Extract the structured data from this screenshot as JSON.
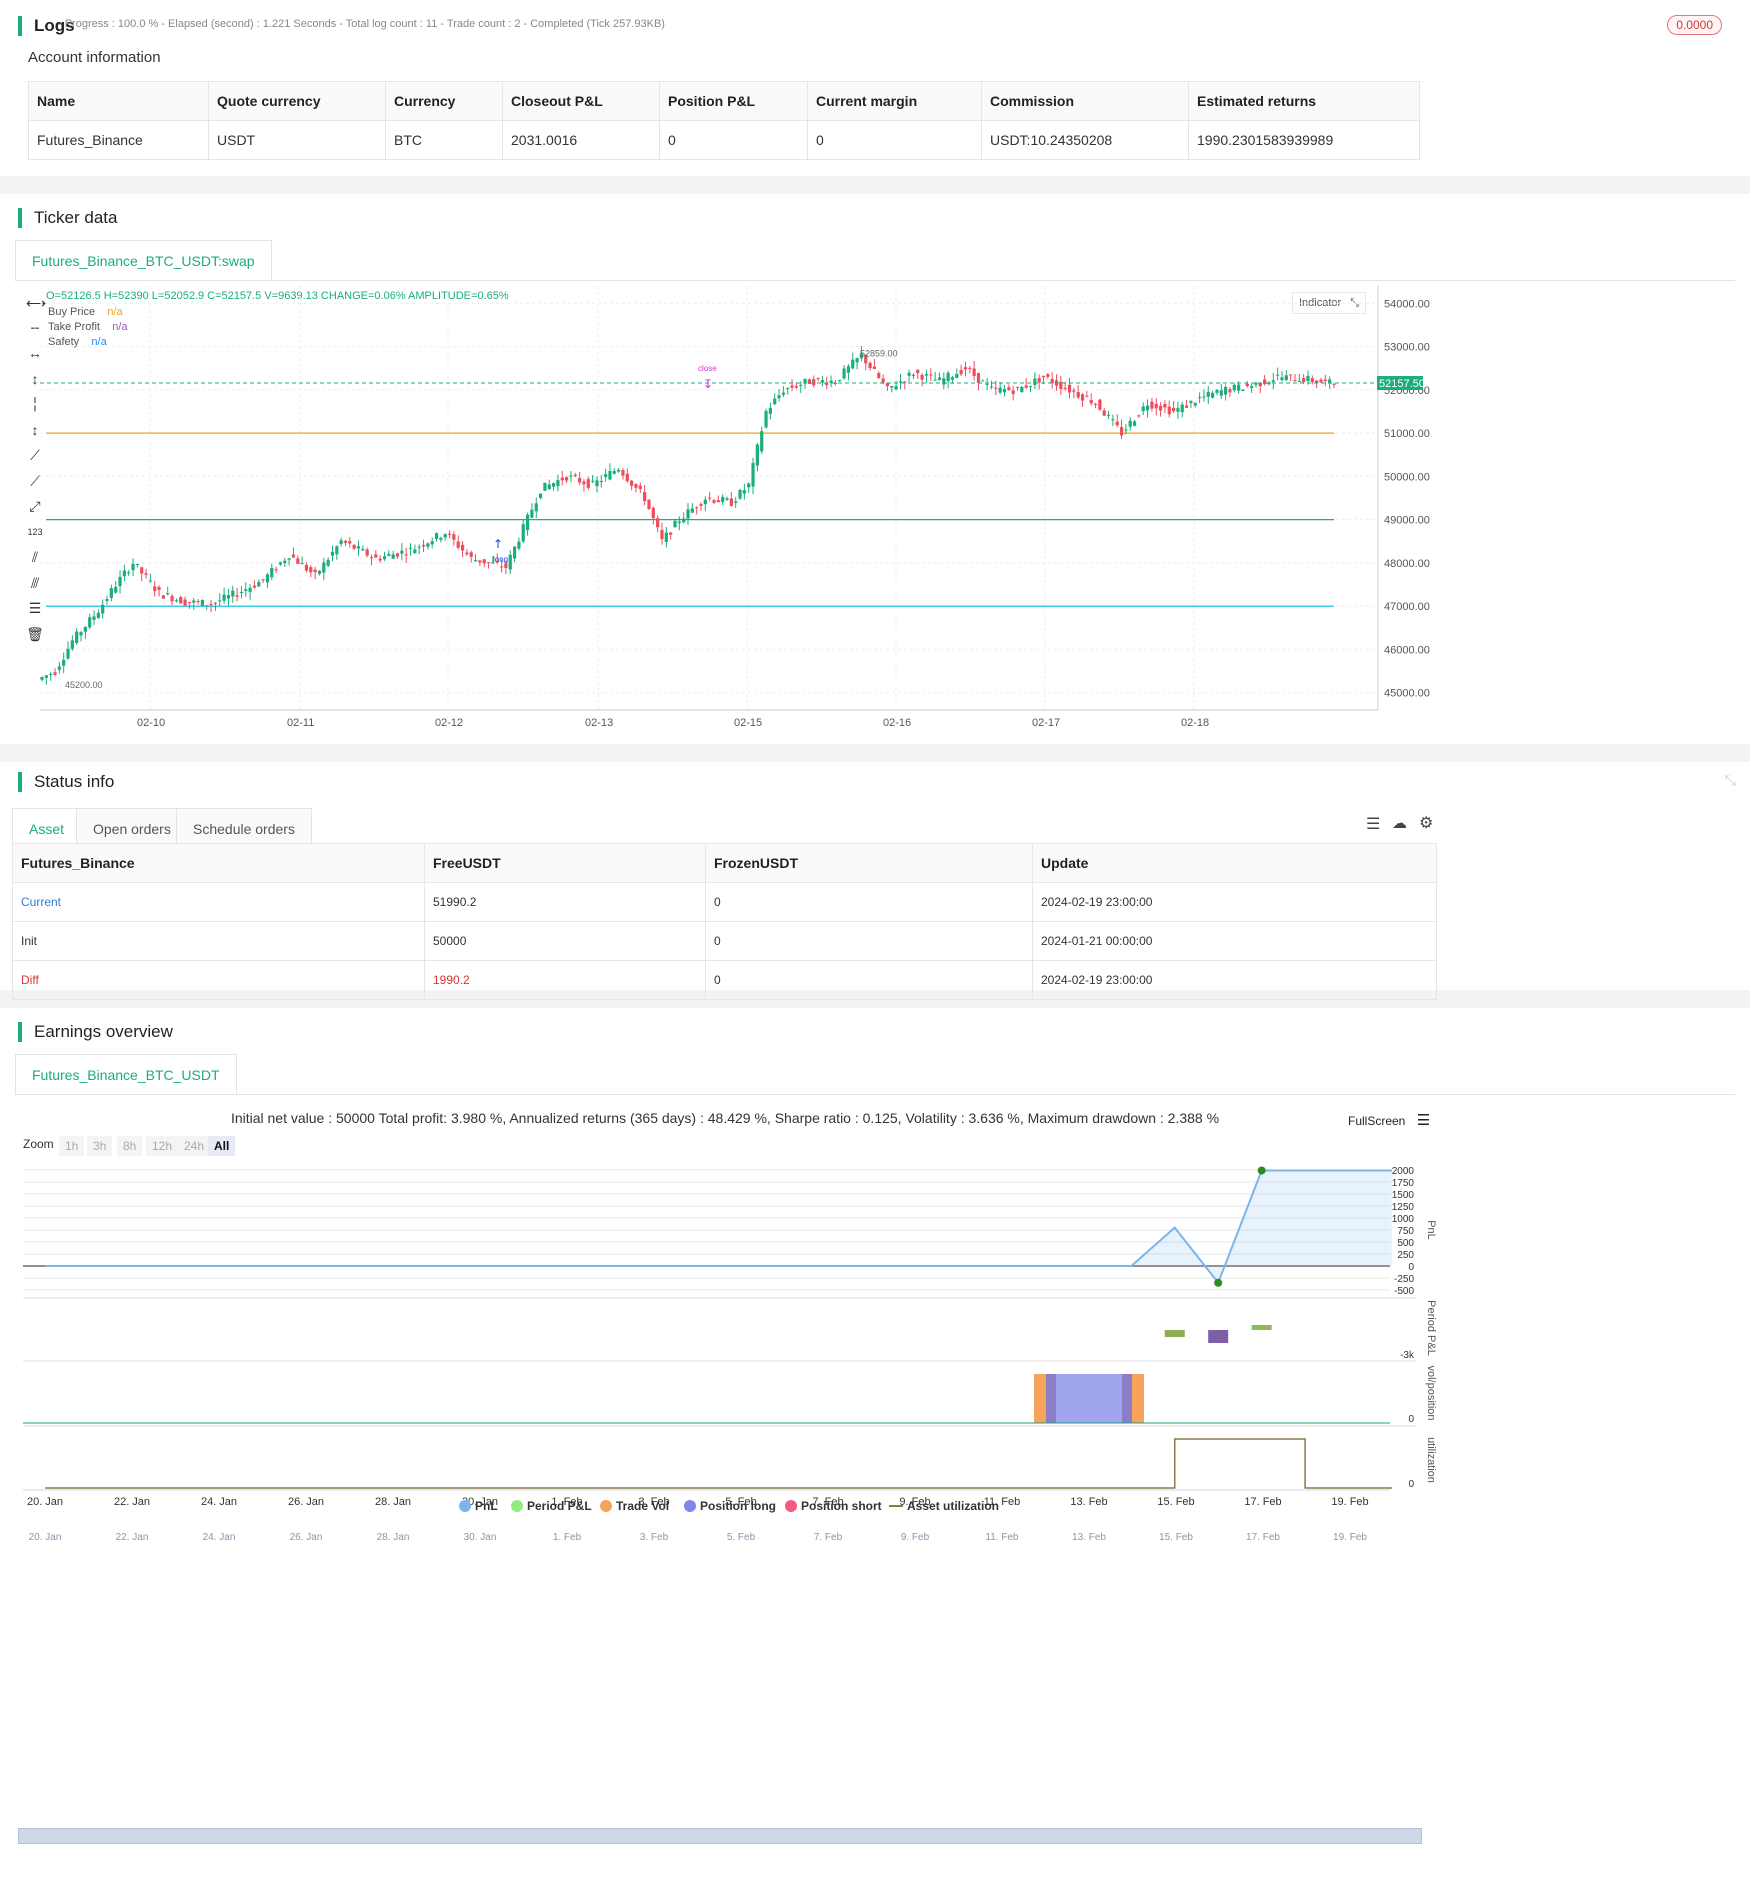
{
  "logs": {
    "title": "Logs",
    "progress": "- Progress : 100.0 % - Elapsed (second) : 1.221  Seconds - Total log count : 11 - Trade count : 2 - Completed (Tick 257.93KB)",
    "badge": "0.0000"
  },
  "account": {
    "title": "Account information",
    "headers": [
      "Name",
      "Quote currency",
      "Currency",
      "Closeout P&L",
      "Position P&L",
      "Current margin",
      "Commission",
      "Estimated returns"
    ],
    "row": [
      "Futures_Binance",
      "USDT",
      "BTC",
      "2031.0016",
      "0",
      "0",
      "USDT:10.24350208",
      "1990.2301583939989"
    ]
  },
  "ticker": {
    "title": "Ticker data",
    "tab": "Futures_Binance_BTC_USDT:swap",
    "ohlc": "O=52126.5 H=52390 L=52052.9 C=52157.5 V=9639.13 CHANGE=0.06% AMPLITUDE=0.65%",
    "legend": [
      {
        "name": "Buy Price",
        "value": "n/a",
        "color": "#f0a020"
      },
      {
        "name": "Take Profit",
        "value": "n/a",
        "color": "#9b59b6"
      },
      {
        "name": "Safety",
        "value": "n/a",
        "color": "#1a8cff"
      }
    ],
    "indicator_button": "Indicator",
    "price_tag": "52157.50",
    "y_ticks": [
      "54000.00",
      "53000.00",
      "52000.00",
      "51000.00",
      "50000.00",
      "49000.00",
      "48000.00",
      "47000.00",
      "46000.00",
      "45000.00"
    ],
    "x_ticks": [
      "02-10",
      "02-11",
      "02-12",
      "02-13",
      "02-15",
      "02-16",
      "02-17",
      "02-18"
    ],
    "high_label": "52859.00",
    "low_label": "45200.00",
    "close_marker": "close",
    "long_marker": "long"
  },
  "chart_data": [
    {
      "type": "candlestick",
      "title": "",
      "x_ticks": [
        "02-10",
        "02-11",
        "02-12",
        "02-13",
        "02-15",
        "02-16",
        "02-17",
        "02-18"
      ],
      "ylim": [
        44600,
        54400
      ],
      "horizontal_lines": [
        {
          "value": 51000,
          "color": "#f0a020"
        },
        {
          "value": 49000,
          "color": "#26a69a"
        },
        {
          "value": 47000,
          "color": "#00bcd4"
        }
      ],
      "last_price": 52157.5,
      "max_high": 52859.0,
      "min_low": 45200.0,
      "anchors": [
        [
          0,
          45300
        ],
        [
          4,
          45500
        ],
        [
          8,
          46200
        ],
        [
          14,
          46900
        ],
        [
          18,
          47500
        ],
        [
          22,
          48000
        ],
        [
          28,
          47300
        ],
        [
          34,
          47100
        ],
        [
          40,
          47050
        ],
        [
          46,
          47300
        ],
        [
          52,
          47600
        ],
        [
          58,
          48200
        ],
        [
          64,
          47700
        ],
        [
          70,
          48500
        ],
        [
          78,
          48100
        ],
        [
          86,
          48300
        ],
        [
          94,
          48700
        ],
        [
          100,
          48100
        ],
        [
          108,
          47900
        ],
        [
          112,
          48800
        ],
        [
          116,
          49700
        ],
        [
          122,
          50000
        ],
        [
          128,
          49800
        ],
        [
          134,
          50200
        ],
        [
          140,
          49500
        ],
        [
          144,
          48500
        ],
        [
          148,
          49000
        ],
        [
          154,
          49500
        ],
        [
          160,
          49400
        ],
        [
          164,
          49800
        ],
        [
          168,
          51500
        ],
        [
          172,
          52000
        ],
        [
          178,
          52200
        ],
        [
          184,
          52200
        ],
        [
          190,
          52800
        ],
        [
          196,
          52000
        ],
        [
          202,
          52400
        ],
        [
          208,
          52200
        ],
        [
          214,
          52500
        ],
        [
          220,
          52000
        ],
        [
          226,
          52000
        ],
        [
          232,
          52300
        ],
        [
          238,
          52000
        ],
        [
          244,
          51700
        ],
        [
          250,
          51000
        ],
        [
          256,
          51700
        ],
        [
          262,
          51500
        ],
        [
          268,
          51800
        ],
        [
          274,
          52000
        ],
        [
          280,
          52100
        ],
        [
          286,
          52300
        ],
        [
          292,
          52250
        ],
        [
          298,
          52150
        ]
      ]
    },
    {
      "type": "line",
      "title": "",
      "x_ticks": [
        "20. Jan",
        "22. Jan",
        "24. Jan",
        "26. Jan",
        "28. Jan",
        "30. Jan",
        "1. Feb",
        "3. Feb",
        "5. Feb",
        "7. Feb",
        "9. Feb",
        "11. Feb",
        "13. Feb",
        "15. Feb",
        "17. Feb",
        "19. Feb"
      ],
      "pnl_ticks": [
        "2000",
        "1750",
        "1500",
        "1250",
        "1000",
        "750",
        "500",
        "250",
        "0",
        "-250",
        "-500"
      ],
      "pnl_ylim": [
        -500,
        2000
      ],
      "series": [
        {
          "name": "PnL",
          "values": [
            0,
            0,
            0,
            0,
            0,
            0,
            0,
            0,
            0,
            0,
            0,
            0,
            0,
            0,
            0,
            0,
            0,
            0,
            0,
            0,
            0,
            0,
            0,
            0,
            0,
            0,
            800,
            -350,
            1990,
            1990,
            1990,
            1990
          ]
        },
        {
          "name": "Period P&L",
          "values": [
            0,
            0,
            0,
            0,
            0,
            0,
            0,
            0,
            0,
            0,
            0,
            0,
            0,
            0,
            0,
            0,
            0,
            0,
            0,
            0,
            0,
            0,
            0,
            0,
            0,
            0,
            -700,
            -1300,
            500,
            0,
            0,
            0
          ]
        },
        {
          "name": "Asset utilization",
          "values": [
            0,
            0,
            0,
            0,
            0,
            0,
            0,
            0,
            0,
            0,
            0,
            0,
            0,
            0,
            0,
            0,
            0,
            0,
            0,
            0,
            0,
            0,
            0,
            0,
            0,
            0,
            1,
            1,
            1,
            0,
            0,
            0
          ]
        }
      ]
    }
  ],
  "status": {
    "title": "Status info",
    "tabs": [
      "Asset",
      "Open orders",
      "Schedule orders"
    ],
    "headers": [
      "Futures_Binance",
      "FreeUSDT",
      "FrozenUSDT",
      "Update"
    ],
    "rows": [
      [
        "Current",
        "51990.2",
        "0",
        "2024-02-19 23:00:00"
      ],
      [
        "Init",
        "50000",
        "0",
        "2024-01-21 00:00:00"
      ],
      [
        "Diff",
        "1990.2",
        "0",
        "2024-02-19 23:00:00"
      ]
    ],
    "colors": {
      "current": "#2a7fd4",
      "diff": "#d9363e"
    }
  },
  "earnings": {
    "title": "Earnings overview",
    "tab": "Futures_Binance_BTC_USDT",
    "summary": "Initial net value : 50000 Total profit: 3.980 %, Annualized returns (365 days) : 48.429 %, Sharpe ratio : 0.125, Volatility : 3.636 %, Maximum drawdown : 2.388 %",
    "fullscreen": "FullScreen",
    "zoom_label": "Zoom",
    "zoom_buttons": [
      "1h",
      "3h",
      "8h",
      "12h",
      "24h",
      "All"
    ],
    "axis_titles": [
      "PnL",
      "Period P&L",
      "vol/position",
      "utilization"
    ],
    "period_tick": "-3k",
    "zero_tick": "0",
    "legend": [
      {
        "name": "PnL",
        "color": "#7cb5ec"
      },
      {
        "name": "Period P&L",
        "color": "#90ed7d"
      },
      {
        "name": "Trade Vol",
        "color": "#f7a35c"
      },
      {
        "name": "Position long",
        "color": "#8085e9"
      },
      {
        "name": "Position short",
        "color": "#f15c80"
      },
      {
        "name": "Asset utilization",
        "color": "#8c7a4a"
      }
    ]
  }
}
